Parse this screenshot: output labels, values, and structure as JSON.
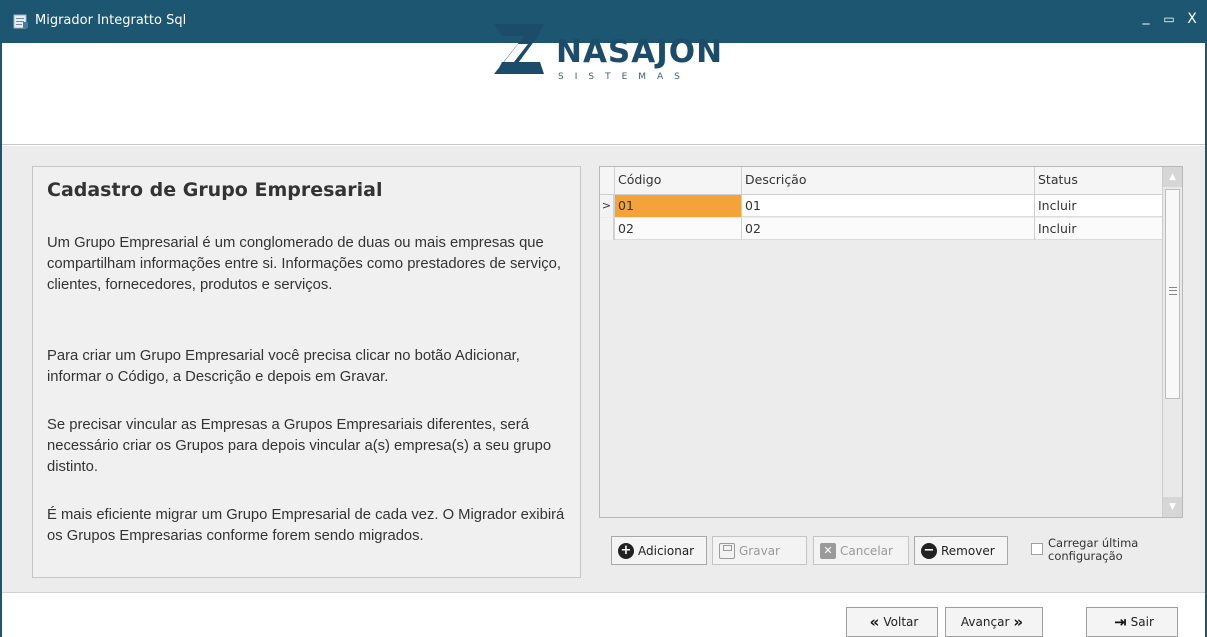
{
  "window": {
    "title": "Migrador Integratto Sql",
    "minimize_glyph": "_",
    "maximize_glyph": "▭",
    "close_glyph": "X"
  },
  "logo": {
    "brand": "NASAJON",
    "subtitle": "SISTEMAS"
  },
  "info": {
    "title": "Cadastro de Grupo Empresarial",
    "paragraphs": [
      "Um Grupo Empresarial é um conglomerado de duas ou mais empresas que compartilham informações entre si. Informações como prestadores de serviço, clientes, fornecedores, produtos e serviços.",
      "Para criar um Grupo Empresarial você precisa clicar no botão Adicionar, informar o Código, a Descrição e depois em Gravar.",
      "Se precisar vincular as Empresas a Grupos Empresariais diferentes, será necessário criar os Grupos para depois vincular a(s) empresa(s) a seu grupo distinto.",
      "É mais eficiente migrar um Grupo Empresarial de cada vez. O Migrador exibirá os Grupos Empresarias conforme forem sendo migrados."
    ]
  },
  "grid": {
    "columns": [
      "Código",
      "Descrição",
      "Status"
    ],
    "rows": [
      {
        "codigo": "01",
        "descricao": "01",
        "status": "Incluir"
      },
      {
        "codigo": "02",
        "descricao": "02",
        "status": "Incluir"
      }
    ],
    "current_row_indicator": ">",
    "selected_row": 0
  },
  "actions": {
    "add_label": "Adicionar",
    "save_label": "Gravar",
    "cancel_label": "Cancelar",
    "remove_label": "Remover",
    "load_last_config_label": "Carregar última configuração",
    "load_last_config_line1": "Carregar última",
    "load_last_config_line2": "configuração",
    "load_last_config_checked": false
  },
  "footer": {
    "back_label": "Voltar",
    "next_label": "Avançar",
    "exit_label": "Sair"
  },
  "colors": {
    "titlebar": "#1c5670",
    "brand": "#1d4c6a",
    "selected_cell": "#f3a33a"
  }
}
